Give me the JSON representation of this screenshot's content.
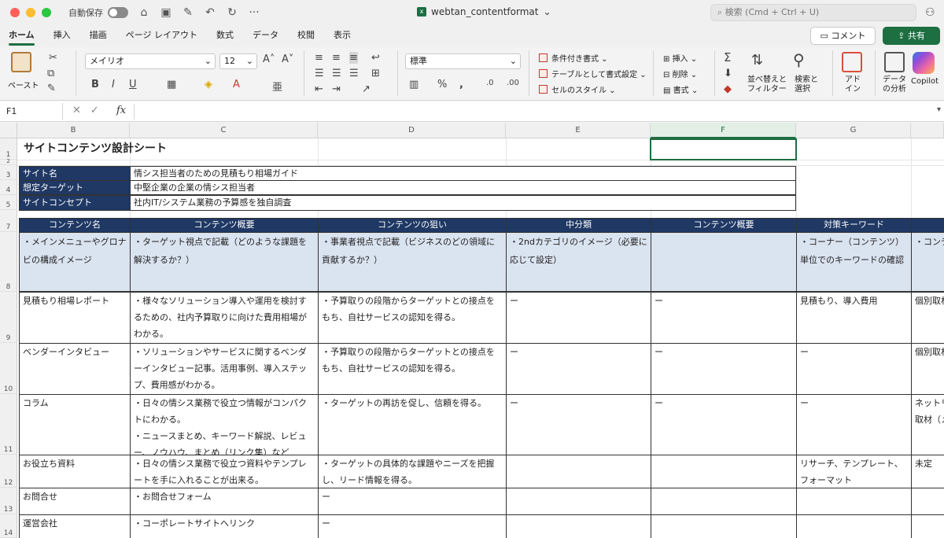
{
  "titlebar": {
    "autosave_label": "自動保存",
    "doc_title": "webtan_contentformat",
    "search_placeholder": "検索 (Cmd + Ctrl + U)"
  },
  "ribbon_tabs": [
    "ホーム",
    "挿入",
    "描画",
    "ページ レイアウト",
    "数式",
    "データ",
    "校閲",
    "表示"
  ],
  "ribbon_buttons": {
    "comment": "コメント",
    "share": "共有",
    "paste": "ペースト",
    "font_name": "メイリオ",
    "font_size": "12",
    "number_format": "標準",
    "conditional_format": "条件付き書式",
    "table_format": "テーブルとして書式設定",
    "cell_style": "セルのスタイル",
    "insert": "挿入",
    "delete": "削除",
    "format": "書式",
    "sort_filter": "並べ替えと\nフィルター",
    "find_select": "検索と\n選択",
    "addins": "アド\nイン",
    "analyze": "データ\nの分析",
    "copilot": "Copilot"
  },
  "formula_bar": {
    "name_box": "F1",
    "formula": ""
  },
  "columns": [
    "B",
    "C",
    "D",
    "E",
    "F",
    "G",
    ""
  ],
  "rows": [
    "1",
    "2",
    "3",
    "4",
    "5",
    "7",
    "8",
    "9",
    "10",
    "11",
    "12",
    "13",
    "14"
  ],
  "sheet": {
    "title": "サイトコンテンツ設計シート",
    "info": [
      {
        "label": "サイト名",
        "value": "情シス担当者のための見積もり相場ガイド"
      },
      {
        "label": "想定ターゲット",
        "value": "中堅企業の企業の情シス担当者"
      },
      {
        "label": "サイトコンセプト",
        "value": "社内IT/システム業務の予算感を独自調査"
      }
    ],
    "headers": [
      "コンテンツ名",
      "コンテンツ概要",
      "コンテンツの狙い",
      "中分類",
      "コンテンツ概要",
      "対策キーワード",
      ""
    ],
    "guide_row": [
      "・メインメニューやグロナビの構成イメージ",
      "・ターゲット視点で記載（どのような課題を解決するか？）",
      "・事業者視点で記載（ビジネスのどの領域に貢献するか？）",
      "・2ndカテゴリのイメージ（必要に応じて設定）",
      "",
      "・コーナー（コンテンツ）単位でのキーワードの確認",
      "・コンテ"
    ],
    "body_rows": [
      [
        "見積もり相場レポート",
        "・様々なソリューション導入や運用を検討するための、社内予算取りに向けた費用相場がわかる。",
        "・予算取りの段階からターゲットとの接点をもち、自社サービスの認知を得る。",
        "ー",
        "ー",
        "見積もり、導入費用",
        "個別取材"
      ],
      [
        "ベンダーインタビュー",
        "・ソリューションやサービスに関するベンダーインタビュー記事。活用事例、導入ステップ、費用感がわかる。",
        "・予算取りの段階からターゲットとの接点をもち、自社サービスの認知を得る。",
        "ー",
        "ー",
        "ー",
        "個別取材"
      ],
      [
        "コラム",
        "・日々の情シス業務で役立つ情報がコンパクトにわかる。\n・ニュースまとめ、キーワード解説、レビュー、ノウハウ、まとめ（リンク集）など",
        "・ターゲットの再訪を促し、信頼を得る。",
        "ー",
        "ー",
        "ー",
        "ネットリ\n取材（メ"
      ],
      [
        "お役立ち資料",
        "・日々の情シス業務で役立つ資料やテンプレートを手に入れることが出来る。",
        "・ターゲットの具体的な課題やニーズを把握し、リード情報を得る。",
        "",
        "",
        "リサーチ、テンプレート、フォーマット",
        "未定"
      ],
      [
        "お問合せ",
        "・お問合せフォーム",
        "ー",
        "",
        "",
        "",
        ""
      ],
      [
        "運営会社",
        "・コーポレートサイトへリンク",
        "ー",
        "",
        "",
        "",
        ""
      ]
    ]
  }
}
